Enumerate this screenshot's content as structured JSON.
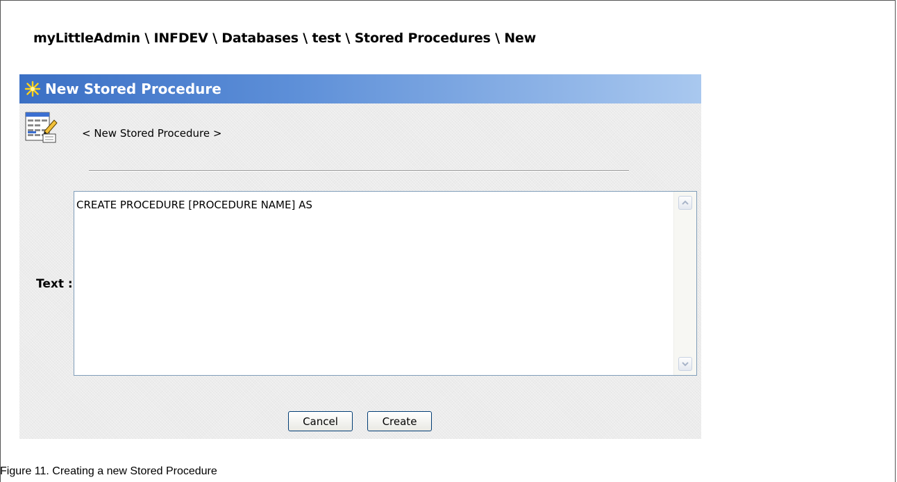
{
  "breadcrumb": "myLittleAdmin \\ INFDEV \\ Databases \\ test \\ Stored Procedures \\ New",
  "panel": {
    "title": "New Stored Procedure",
    "title_icon": "star-icon",
    "procedure_icon": "stored-procedure-icon",
    "procedure_name": "< New Stored Procedure >",
    "text_label": "Text :",
    "sql_text": "CREATE PROCEDURE [PROCEDURE NAME] AS",
    "buttons": {
      "cancel_label": "Cancel",
      "create_label": "Create"
    }
  },
  "caption": "Figure 11. Creating a new Stored Procedure",
  "colors": {
    "titlebar_start": "#3a6fc4",
    "titlebar_end": "#a9c8ef",
    "panel_background": "#ececec",
    "star": "#ffd21a"
  }
}
